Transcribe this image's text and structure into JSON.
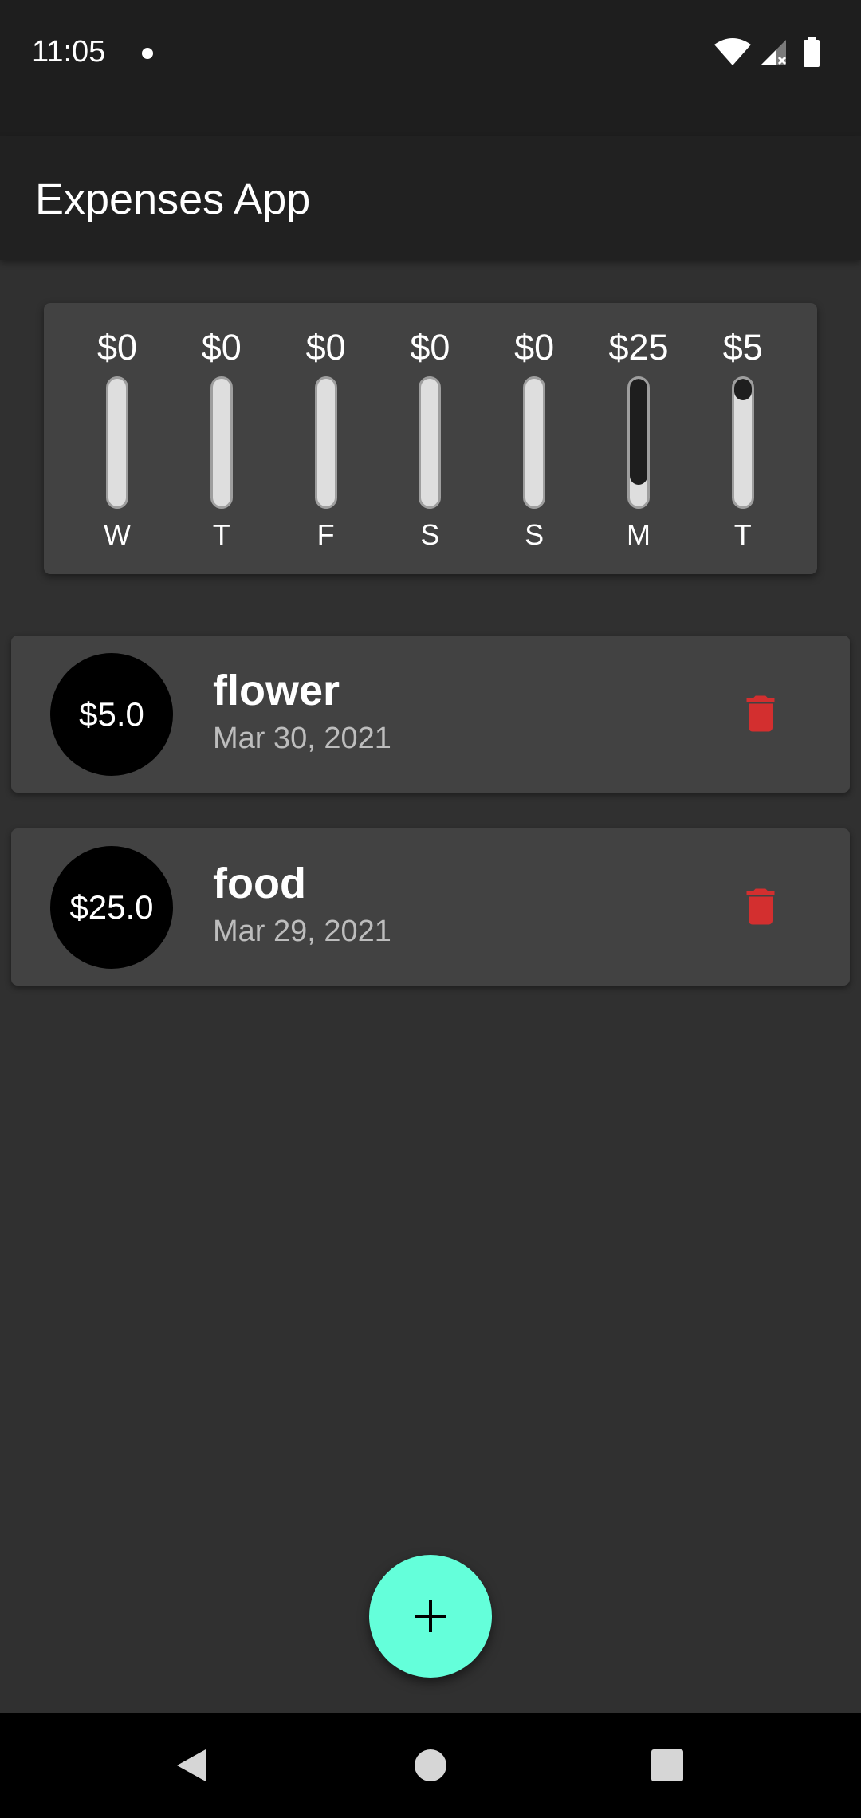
{
  "status_bar": {
    "time": "11:05",
    "icons": [
      "notification-dot-icon",
      "wifi-icon",
      "cell-signal-icon",
      "battery-icon"
    ]
  },
  "app_bar": {
    "title": "Expenses App"
  },
  "chart": {
    "bars": [
      {
        "amount": "$0",
        "day": "W",
        "fraction": 0
      },
      {
        "amount": "$0",
        "day": "T",
        "fraction": 0
      },
      {
        "amount": "$0",
        "day": "F",
        "fraction": 0
      },
      {
        "amount": "$0",
        "day": "S",
        "fraction": 0
      },
      {
        "amount": "$0",
        "day": "S",
        "fraction": 0
      },
      {
        "amount": "$25",
        "day": "M",
        "fraction": 0.833
      },
      {
        "amount": "$5",
        "day": "T",
        "fraction": 0.167
      }
    ],
    "fill_color": "#1e1e1e",
    "track_color": "#dedede"
  },
  "transactions": [
    {
      "amount": "$5.0",
      "title": "flower",
      "date": "Mar 30, 2021"
    },
    {
      "amount": "$25.0",
      "title": "food",
      "date": "Mar 29, 2021"
    }
  ],
  "fab": {
    "icon": "plus-icon",
    "color": "#64ffda"
  },
  "nav_bar": {
    "icons": [
      "back-icon",
      "home-icon",
      "recents-icon"
    ]
  },
  "colors": {
    "background": "#303030",
    "card": "#424242",
    "app_bar": "#212121",
    "delete": "#d32f2f",
    "accent": "#64ffda"
  }
}
